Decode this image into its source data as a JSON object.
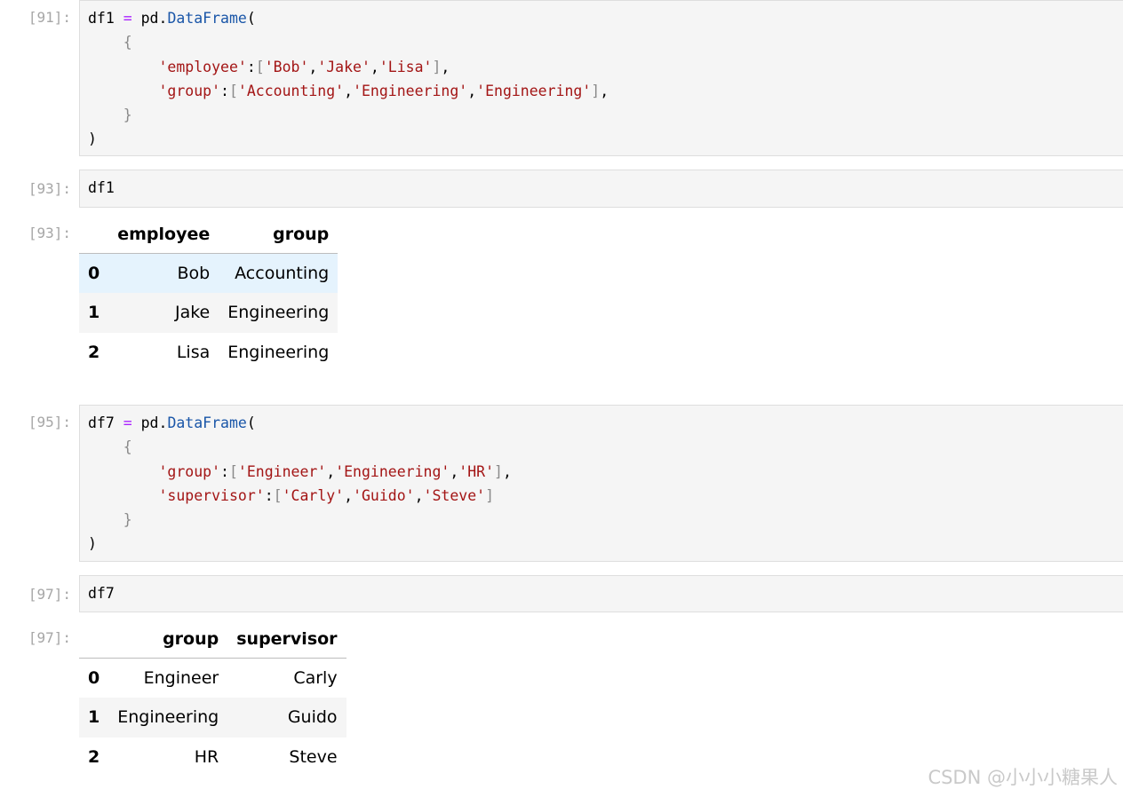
{
  "cells": [
    {
      "prompt": "[91]:",
      "code": [
        [
          {
            "t": "df1 "
          },
          {
            "t": "=",
            "c": "op"
          },
          {
            "t": " pd."
          },
          {
            "t": "DataFrame",
            "c": "fn"
          },
          {
            "t": "("
          }
        ],
        [
          {
            "t": "    "
          },
          {
            "t": "{",
            "c": "br"
          }
        ],
        [
          {
            "t": "        "
          },
          {
            "t": "'employee'",
            "c": "str"
          },
          {
            "t": ":"
          },
          {
            "t": "[",
            "c": "br"
          },
          {
            "t": "'Bob'",
            "c": "str"
          },
          {
            "t": ","
          },
          {
            "t": "'Jake'",
            "c": "str"
          },
          {
            "t": ","
          },
          {
            "t": "'Lisa'",
            "c": "str"
          },
          {
            "t": "]",
            "c": "br"
          },
          {
            "t": ","
          }
        ],
        [
          {
            "t": "        "
          },
          {
            "t": "'group'",
            "c": "str"
          },
          {
            "t": ":"
          },
          {
            "t": "[",
            "c": "br"
          },
          {
            "t": "'Accounting'",
            "c": "str"
          },
          {
            "t": ","
          },
          {
            "t": "'Engineering'",
            "c": "str"
          },
          {
            "t": ","
          },
          {
            "t": "'Engineering'",
            "c": "str"
          },
          {
            "t": "]",
            "c": "br"
          },
          {
            "t": ","
          }
        ],
        [
          {
            "t": "    "
          },
          {
            "t": "}",
            "c": "br"
          }
        ],
        [
          {
            "t": ")"
          }
        ]
      ]
    },
    {
      "prompt": "[93]:",
      "code": [
        [
          {
            "t": "df1"
          }
        ]
      ]
    },
    {
      "prompt": "[95]:",
      "code": [
        [
          {
            "t": "df7 "
          },
          {
            "t": "=",
            "c": "op"
          },
          {
            "t": " pd."
          },
          {
            "t": "DataFrame",
            "c": "fn"
          },
          {
            "t": "("
          }
        ],
        [
          {
            "t": "    "
          },
          {
            "t": "{",
            "c": "br"
          }
        ],
        [
          {
            "t": "        "
          },
          {
            "t": "'group'",
            "c": "str"
          },
          {
            "t": ":"
          },
          {
            "t": "[",
            "c": "br"
          },
          {
            "t": "'Engineer'",
            "c": "str"
          },
          {
            "t": ","
          },
          {
            "t": "'Engineering'",
            "c": "str"
          },
          {
            "t": ","
          },
          {
            "t": "'HR'",
            "c": "str"
          },
          {
            "t": "]",
            "c": "br"
          },
          {
            "t": ","
          }
        ],
        [
          {
            "t": "        "
          },
          {
            "t": "'supervisor'",
            "c": "str"
          },
          {
            "t": ":"
          },
          {
            "t": "[",
            "c": "br"
          },
          {
            "t": "'Carly'",
            "c": "str"
          },
          {
            "t": ","
          },
          {
            "t": "'Guido'",
            "c": "str"
          },
          {
            "t": ","
          },
          {
            "t": "'Steve'",
            "c": "str"
          },
          {
            "t": "]",
            "c": "br"
          }
        ],
        [
          {
            "t": "    "
          },
          {
            "t": "}",
            "c": "br"
          }
        ],
        [
          {
            "t": ")"
          }
        ]
      ]
    },
    {
      "prompt": "[97]:",
      "code": [
        [
          {
            "t": "df7"
          }
        ]
      ]
    }
  ],
  "outputs": [
    {
      "prompt": "[93]:",
      "columns": [
        "employee",
        "group"
      ],
      "rows": [
        {
          "index": "0",
          "cells": [
            "Bob",
            "Accounting"
          ]
        },
        {
          "index": "1",
          "cells": [
            "Jake",
            "Engineering"
          ]
        },
        {
          "index": "2",
          "cells": [
            "Lisa",
            "Engineering"
          ]
        }
      ]
    },
    {
      "prompt": "[97]:",
      "columns": [
        "group",
        "supervisor"
      ],
      "rows": [
        {
          "index": "0",
          "cells": [
            "Engineer",
            "Carly"
          ]
        },
        {
          "index": "1",
          "cells": [
            "Engineering",
            "Guido"
          ]
        },
        {
          "index": "2",
          "cells": [
            "HR",
            "Steve"
          ]
        }
      ]
    }
  ],
  "watermark": "CSDN @小小小糖果人",
  "colors": {
    "code_bg": "#f5f5f5",
    "prompt": "#a6a6a6",
    "operator": "#aa22ff",
    "function": "#1a56a8",
    "string": "#a31515",
    "bracket": "#8a8a8a",
    "row_hover": "#e5f3fd",
    "row_stripe": "#f5f5f5"
  }
}
